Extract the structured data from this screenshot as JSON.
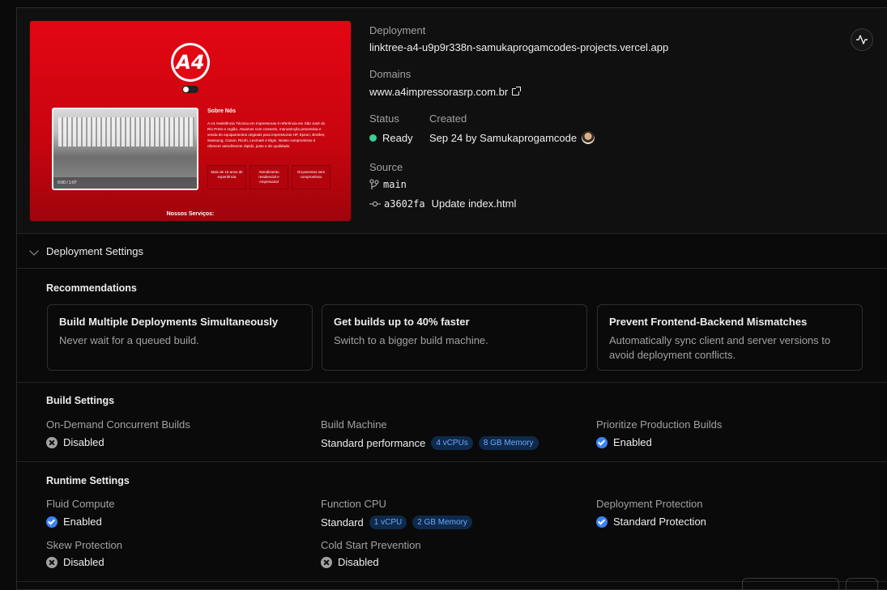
{
  "preview": {
    "logo_text": "A4",
    "sobre_title": "Sobre Nós",
    "sobre_text": "A A4 Assistência Técnica em Impressoras é referência em São José do Rio Preto e região. Atuamos com conserto, manutenção preventiva e venda de equipamentos originais para impressoras HP, Epson, Brother, Samsung, Canon, Ricoh, Lexmark e Elgin. Nosso compromisso é oferecer atendimento rápido, justo e de qualidade.",
    "video_time": "0:00 / 1:07",
    "cards": [
      "Mais de 10 anos de experiência",
      "Atendimento residencial e empresarial",
      "Orçamentos sem compromisso"
    ],
    "servicos": "Nossos Serviços:"
  },
  "deployment": {
    "label": "Deployment",
    "url": "linktree-a4-u9p9r338n-samukaprogamcodes-projects.vercel.app",
    "domains_label": "Domains",
    "domain": "www.a4impressorasrp.com.br",
    "status_label": "Status",
    "status": "Ready",
    "created_label": "Created",
    "created": "Sep 24 by Samukaprogamcode",
    "source_label": "Source",
    "branch": "main",
    "commit_hash": "a3602fa",
    "commit_msg": "Update index.html"
  },
  "settings": {
    "header": "Deployment Settings",
    "recommendations_title": "Recommendations",
    "recommendations": [
      {
        "title": "Build Multiple Deployments Simultaneously",
        "desc": "Never wait for a queued build."
      },
      {
        "title": "Get builds up to 40% faster",
        "desc": "Switch to a bigger build machine."
      },
      {
        "title": "Prevent Frontend-Backend Mismatches",
        "desc": "Automatically sync client and server versions to avoid deployment conflicts."
      }
    ],
    "build": {
      "title": "Build Settings",
      "concurrent_label": "On-Demand Concurrent Builds",
      "concurrent_value": "Disabled",
      "machine_label": "Build Machine",
      "machine_value": "Standard performance",
      "machine_cpu": "4 vCPUs",
      "machine_mem": "8 GB Memory",
      "priority_label": "Prioritize Production Builds",
      "priority_value": "Enabled"
    },
    "runtime": {
      "title": "Runtime Settings",
      "fluid_label": "Fluid Compute",
      "fluid_value": "Enabled",
      "cpu_label": "Function CPU",
      "cpu_value": "Standard",
      "cpu_vcpu": "1 vCPU",
      "cpu_mem": "2 GB Memory",
      "protection_label": "Deployment Protection",
      "protection_value": "Standard Protection",
      "skew_label": "Skew Protection",
      "skew_value": "Disabled",
      "cold_label": "Cold Start Prevention",
      "cold_value": "Disabled"
    }
  },
  "colors": {
    "ready": "#3ccf91",
    "enabled": "#3b82f6",
    "brand_red": "#e30613"
  }
}
